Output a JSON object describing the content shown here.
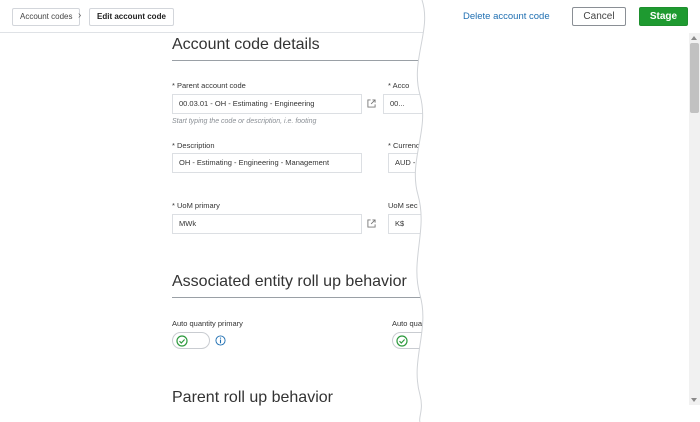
{
  "breadcrumb": {
    "root": "Account codes",
    "separator": "›",
    "current": "Edit account code"
  },
  "header": {
    "delete_label": "Delete account code",
    "cancel_label": "Cancel",
    "stage_label": "Stage"
  },
  "details": {
    "title": "Account code details",
    "parent": {
      "label": "* Parent account code",
      "value": "00.03.01 - OH - Estimating - Engineering",
      "hint": "Start typing the code or description, i.e. footing"
    },
    "account": {
      "label": "* Acco",
      "value": "00..."
    },
    "description": {
      "label": "* Description",
      "value": "OH - Estimating - Engineering - Management"
    },
    "currency": {
      "label": "* Currency",
      "value": "AUD -"
    },
    "uom_primary": {
      "label": "* UoM primary",
      "value": "MWk"
    },
    "uom_secondary": {
      "label": "UoM sec",
      "value": "K$"
    }
  },
  "associated": {
    "title": "Associated entity roll up behavior",
    "auto_qty_primary": {
      "label": "Auto quantity primary",
      "enabled": true
    },
    "auto_qty_secondary": {
      "label": "Auto quan",
      "enabled": true
    }
  },
  "parent_rollup": {
    "title": "Parent roll up behavior"
  },
  "colors": {
    "accent": "#1f6fb2",
    "stage": "#1e9a30",
    "toggle_check": "#2e9a3e"
  }
}
